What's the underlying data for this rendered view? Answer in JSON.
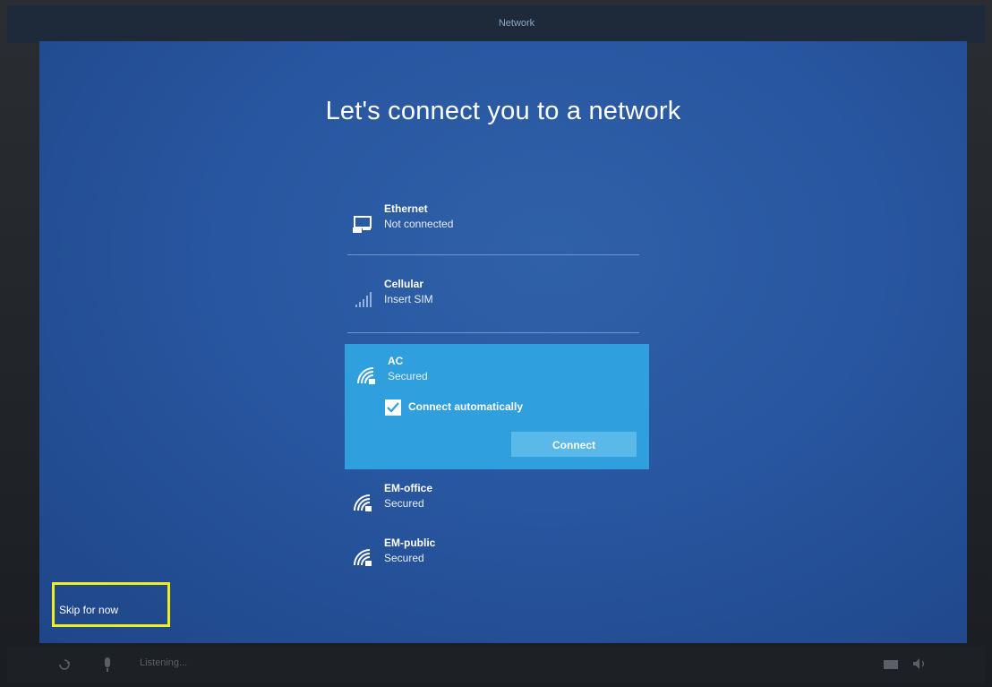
{
  "window": {
    "top_tab": "Network"
  },
  "page": {
    "title": "Let's connect you to a network"
  },
  "networks": [
    {
      "icon": "ethernet-icon",
      "name": "Ethernet",
      "status": "Not connected"
    },
    {
      "icon": "cellular-signal-icon",
      "name": "Cellular",
      "status": "Insert SIM"
    },
    {
      "icon": "wifi-secured-icon",
      "name": "AC",
      "status": "Secured",
      "selected": true,
      "connect_automatically_label": "Connect automatically",
      "connect_automatically_checked": true,
      "connect_button_label": "Connect"
    },
    {
      "icon": "wifi-secured-icon",
      "name": "EM-office",
      "status": "Secured"
    },
    {
      "icon": "wifi-secured-icon",
      "name": "EM-public",
      "status": "Secured"
    }
  ],
  "skip": {
    "label": "Skip for now"
  },
  "bottom_bar": {
    "listening_label": "Listening...",
    "icons": [
      "ease-of-access-icon",
      "microphone-icon",
      "keyboard-icon",
      "volume-icon"
    ]
  },
  "colors": {
    "screen_bg": "#2856a0",
    "selected_bg": "#2f9fdd",
    "connect_button_bg": "#5ab9e8",
    "highlight_border": "#f0ee1e"
  }
}
